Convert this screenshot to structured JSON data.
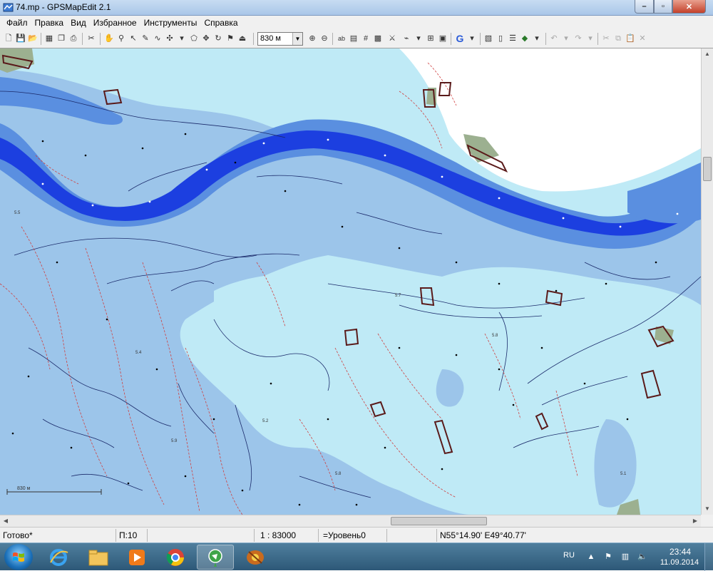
{
  "window": {
    "title": "74.mp - GPSMapEdit 2.1",
    "controls": {
      "minimize": "–",
      "maximize": "▫",
      "close": "✕"
    }
  },
  "menu": [
    "Файл",
    "Правка",
    "Вид",
    "Избранное",
    "Инструменты",
    "Справка"
  ],
  "toolbar": {
    "scale_value": "830 м",
    "text_tool": "ab",
    "google_label": "G"
  },
  "map": {
    "colors": {
      "land": "#ffffff",
      "shallow": "#bfeaf6",
      "medium": "#9cc5ea",
      "deep": "#5a8fe0",
      "channel": "#1c3fe0",
      "channel_deep": "#1a1ad8",
      "vegetation": "#9cb090",
      "building": "#5a1a1a",
      "contour": "#1a2a6a",
      "isobath": "#d04040"
    },
    "depth_labels": [
      "5.7",
      "5.5",
      "5.2",
      "5.8",
      "5.9",
      "5.8",
      "5.1",
      "5.4"
    ],
    "scale_bar_label": "830 м"
  },
  "status": {
    "ready": "Готово*",
    "objects": "П:10",
    "scale": "1 : 83000",
    "level": "=Уровень0",
    "coords": "N55°14.90' E49°40.77'"
  },
  "taskbar": {
    "apps": [
      "internet-explorer",
      "file-explorer",
      "media-player",
      "chrome",
      "gpsmapedit",
      "map-viewer"
    ],
    "language": "RU",
    "time": "23:44",
    "date": "11.09.2014"
  }
}
